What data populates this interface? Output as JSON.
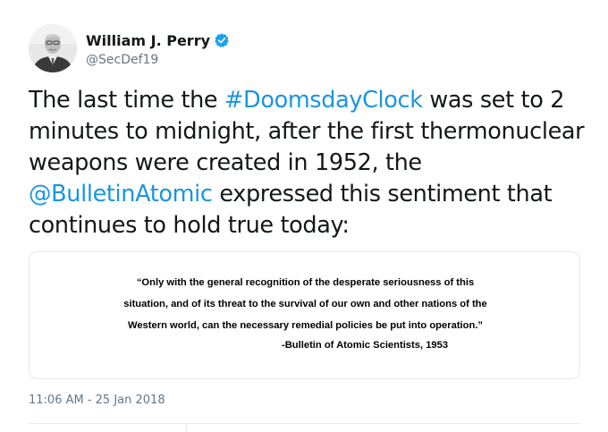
{
  "author": {
    "name": "William J. Perry",
    "handle": "@SecDef19",
    "verified": true,
    "avatar_icon": "profile-photo-icon"
  },
  "tweet": {
    "segments": [
      {
        "text": "The last time the ",
        "type": "text"
      },
      {
        "text": "#DoomsdayClock",
        "type": "hashtag"
      },
      {
        "text": " was set to 2 minutes to midnight, after the first thermonuclear weapons were created in 1952, the ",
        "type": "text"
      },
      {
        "text": "@BulletinAtomic",
        "type": "mention"
      },
      {
        "text": " expressed this sentiment that continues to hold true today:",
        "type": "text"
      }
    ],
    "timestamp": "11:06 AM - 25 Jan 2018"
  },
  "media": {
    "quote_lines": [
      "“Only with the general recognition of the desperate seriousness of this",
      "situation, and of its threat to the survival of our own and other nations of the",
      "Western world, can the necessary remedial policies be put into operation.”"
    ],
    "attribution": "-Bulletin of Atomic Scientists, 1953"
  },
  "colors": {
    "link": "#1b95e0",
    "text": "#14171a",
    "secondary": "#657786",
    "border": "#e1e8ed",
    "verified": "#1da1f2"
  }
}
